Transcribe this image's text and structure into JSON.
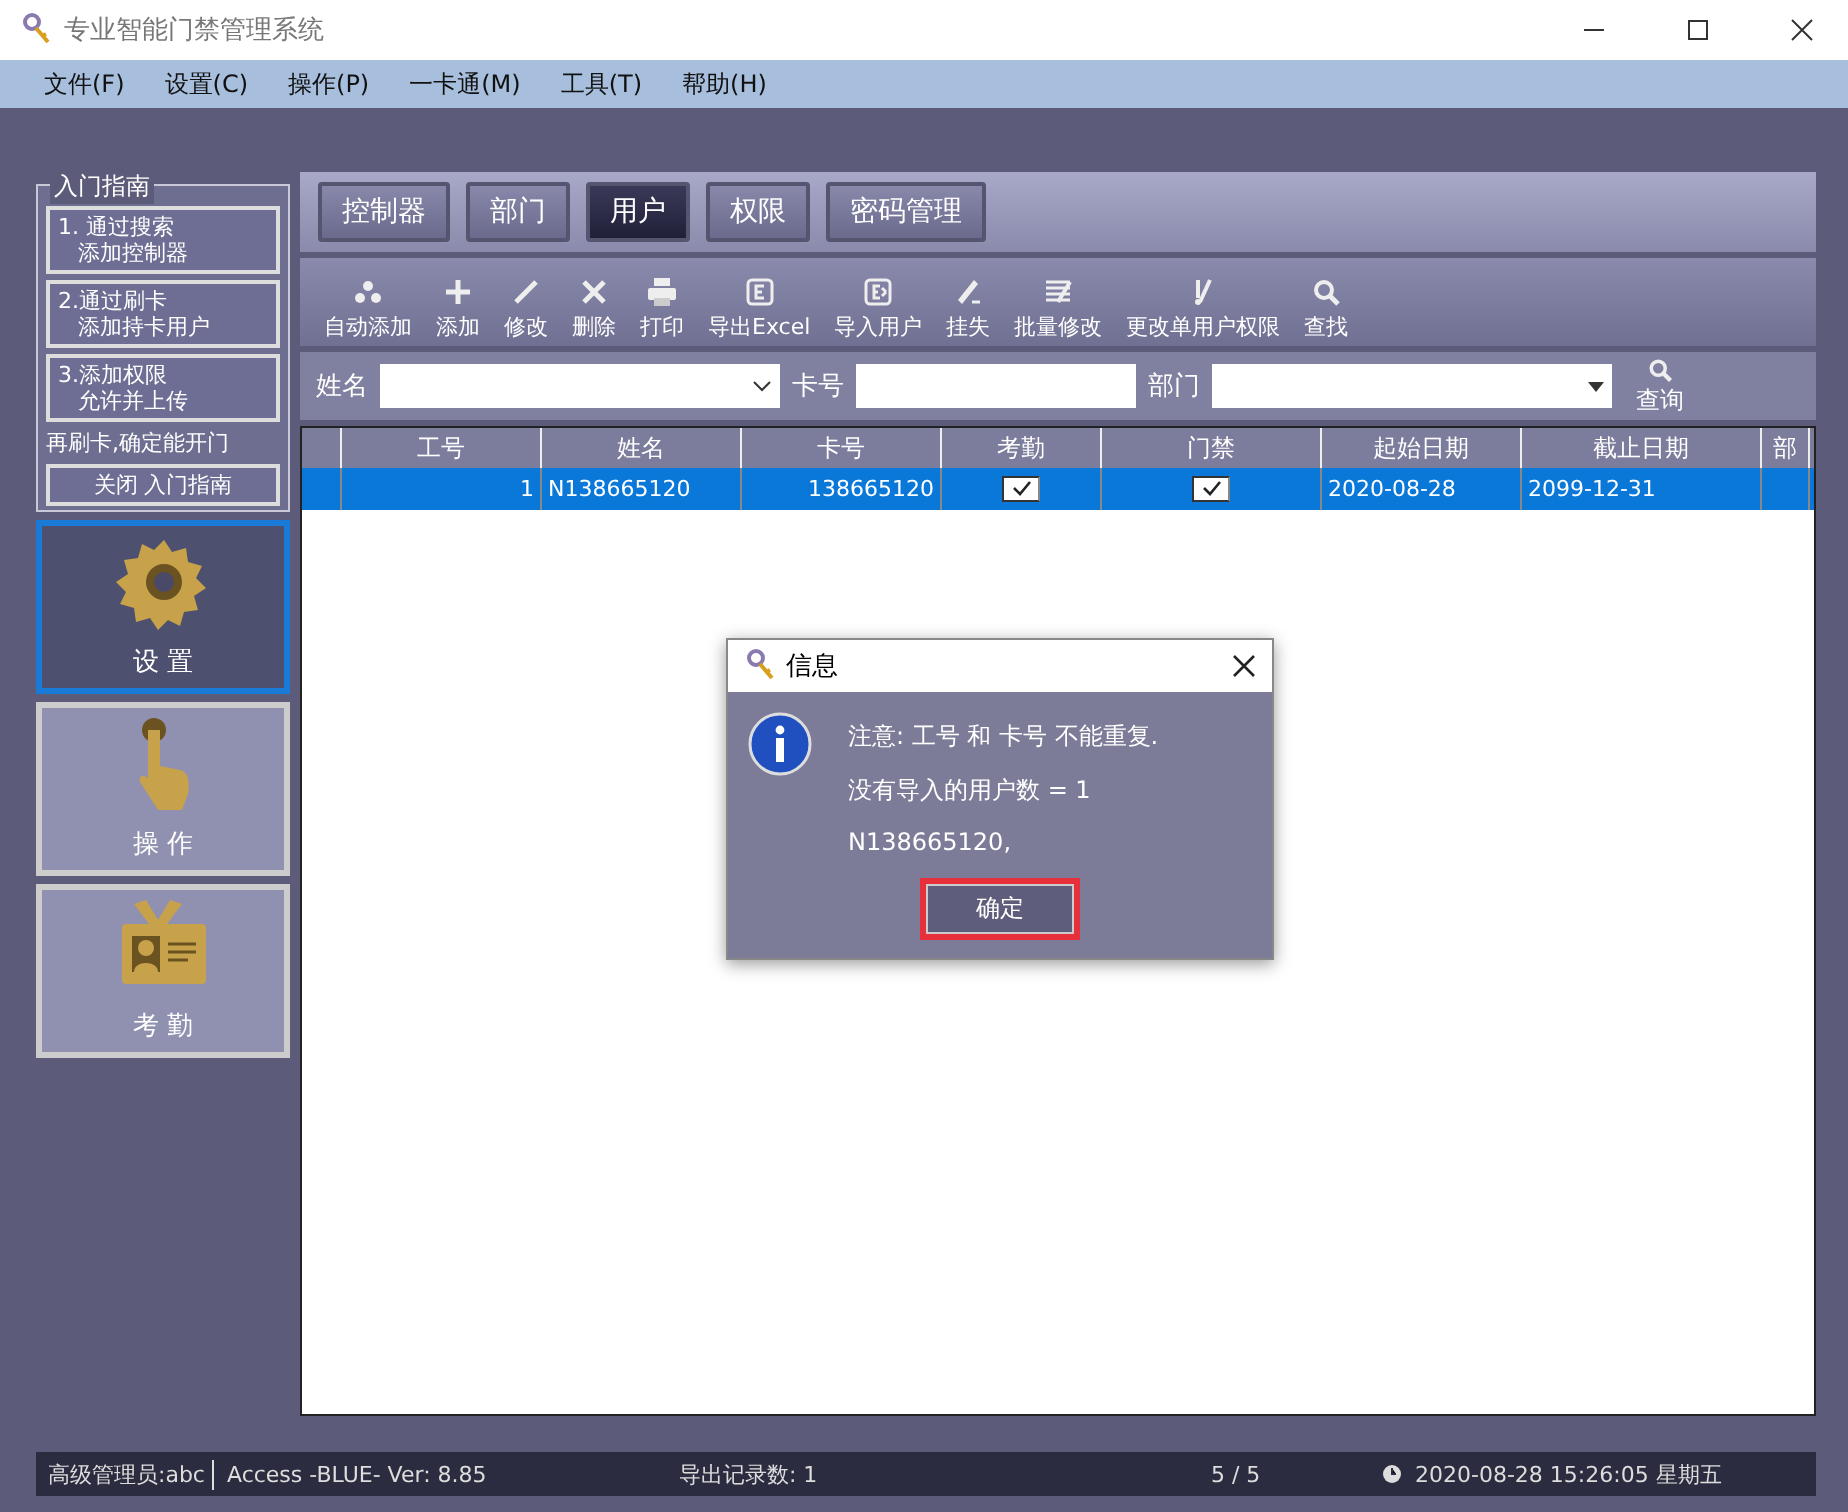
{
  "window": {
    "title": "专业智能门禁管理系统"
  },
  "menu": [
    "文件(F)",
    "设置(C)",
    "操作(P)",
    "一卡通(M)",
    "工具(T)",
    "帮助(H)"
  ],
  "guide": {
    "title": "入门指南",
    "steps": [
      {
        "lines": [
          "1.  通过搜索",
          "添加控制器"
        ]
      },
      {
        "lines": [
          "2.通过刷卡",
          "添加持卡用户"
        ]
      },
      {
        "lines": [
          "3.添加权限",
          "允许并上传"
        ]
      }
    ],
    "note": "再刷卡,确定能开门",
    "close": "关闭 入门指南"
  },
  "nav": [
    {
      "label": "设 置",
      "selected": true
    },
    {
      "label": "操 作",
      "selected": false
    },
    {
      "label": "考 勤",
      "selected": false
    }
  ],
  "tabs": [
    {
      "label": "控制器",
      "selected": false
    },
    {
      "label": "部门",
      "selected": false
    },
    {
      "label": "用户",
      "selected": true
    },
    {
      "label": "权限",
      "selected": false
    },
    {
      "label": "密码管理",
      "selected": false
    }
  ],
  "toolbar": [
    "自动添加",
    "添加",
    "修改",
    "删除",
    "打印",
    "导出Excel",
    "导入用户",
    "挂失",
    "批量修改",
    "更改单用户权限",
    "查找"
  ],
  "filters": {
    "name_label": "姓名",
    "card_label": "卡号",
    "dept_label": "部门",
    "query": "查询"
  },
  "table": {
    "columns": [
      "工号",
      "姓名",
      "卡号",
      "考勤",
      "门禁",
      "起始日期",
      "截止日期",
      "部"
    ],
    "rows": [
      {
        "selected": true,
        "id": "1",
        "name": "N138665120",
        "card": "138665120",
        "attendance": true,
        "access": true,
        "start": "2020-08-28",
        "end": "2099-12-31"
      }
    ]
  },
  "dialog": {
    "title": "信息",
    "lines": [
      "注意: 工号 和 卡号 不能重复.",
      "没有导入的用户数 = 1",
      "N138665120,"
    ],
    "button": "确定"
  },
  "status_bar": {
    "user": "高级管理员:abc",
    "version": "Access -BLUE- Ver: 8.85",
    "records": "导出记录数: 1",
    "pages": "5 / 5",
    "datetime": "2020-08-28 15:26:05 星期五"
  }
}
